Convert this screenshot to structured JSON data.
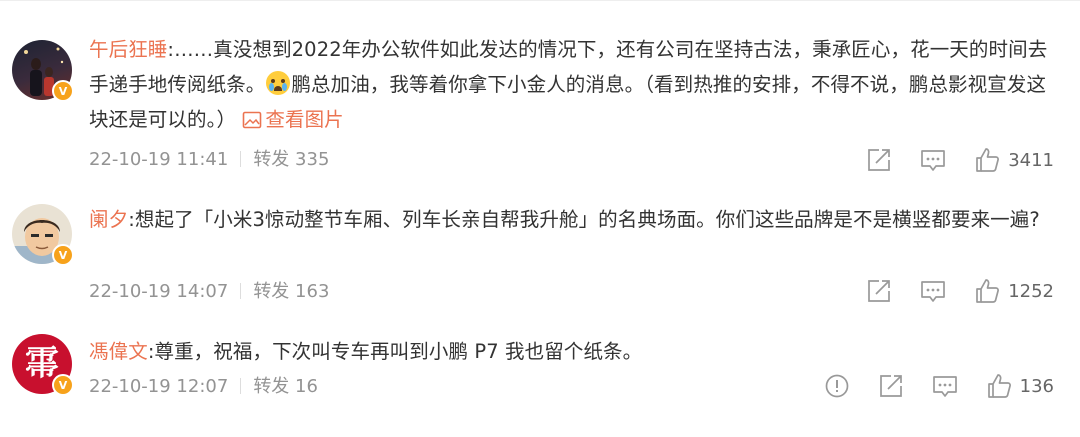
{
  "comments": [
    {
      "username": "午后狂睡",
      "text_before_emoji": ":……真没想到2022年办公软件如此发达的情况下，还有公司在坚持古法，秉承匠心，花一天的时间去手递手地传阅纸条。",
      "emoji": "crying-face-icon",
      "text_after_emoji": "鹏总加油，我等着你拿下小金人的消息。（看到热推的安排，不得不说，鹏总影视宣发这块还是可以的。）",
      "view_pic_label": "查看图片",
      "time": "22-10-19 11:41",
      "repost_label": "转发 335",
      "like_count": "3411"
    },
    {
      "username": "阑夕",
      "text": ":想起了「小米3惊动整节车厢、列车长亲自帮我升舱」的名典场面。你们这些品牌是不是横竖都要来一遍?",
      "time": "22-10-19 14:07",
      "repost_label": "转发 163",
      "like_count": "1252"
    },
    {
      "username": "馮偉文",
      "avatar_char": "𢄀",
      "text": ":尊重，祝福，下次叫专车再叫到小鹏 P7 我也留个纸条。",
      "time": "22-10-19 12:07",
      "repost_label": "转发 16",
      "like_count": "136"
    }
  ],
  "colors": {
    "username": "#eb7350",
    "meta": "#939393",
    "badge": "#f7a21b"
  }
}
